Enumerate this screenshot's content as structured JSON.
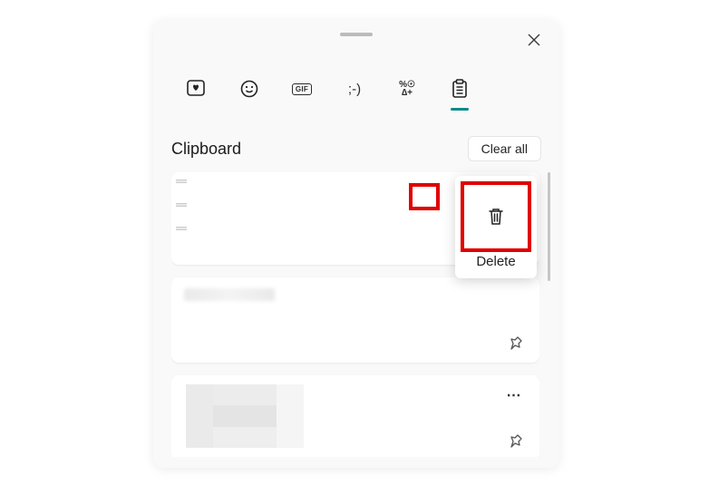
{
  "header": {
    "title": "Clipboard",
    "clear_all_label": "Clear all"
  },
  "tabs": {
    "emoji_heart": "emoji-heart",
    "emoji_face": "emoji-face",
    "gif": "GIF",
    "kaomoji": ";-)",
    "symbols_top": "%☉",
    "symbols_bottom": "∆+",
    "clipboard": "clipboard"
  },
  "popup": {
    "label": "Delete"
  },
  "items": [
    {
      "type": "image",
      "has_more": true,
      "has_pin": true,
      "highlighted": true
    },
    {
      "type": "text",
      "has_more": false,
      "has_pin": true
    },
    {
      "type": "image",
      "has_more": true,
      "has_pin": true
    }
  ],
  "more_glyph": "⋯"
}
